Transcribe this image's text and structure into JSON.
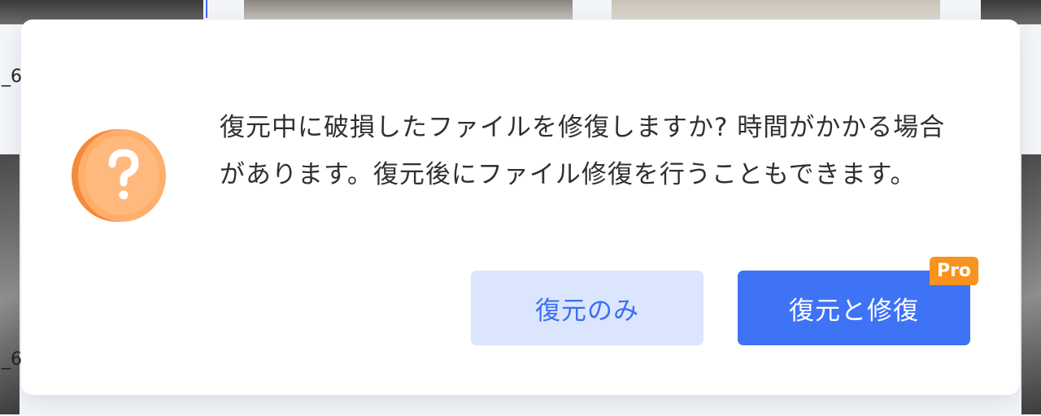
{
  "dialog": {
    "message": "復元中に破損したファイルを修復しますか? 時間がかかる場合があります。復元後にファイル修復を行うこともできます。",
    "icon": "question-coin-icon",
    "buttons": {
      "restore_only": "復元のみ",
      "restore_and_repair": "復元と修復",
      "pro_badge": "Pro"
    }
  },
  "background": {
    "left_label_top": "_6",
    "left_label_bottom": "_6"
  },
  "colors": {
    "primary": "#3e73f6",
    "secondary_bg": "#dbe5fd",
    "badge": "#f7931e",
    "icon_orange": "#ff9a4a"
  }
}
